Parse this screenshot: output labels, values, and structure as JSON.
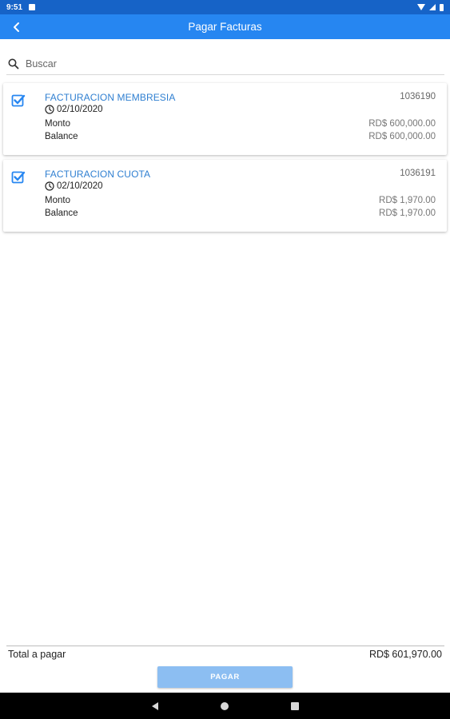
{
  "status_bar": {
    "time": "9:51"
  },
  "app_bar": {
    "title": "Pagar Facturas"
  },
  "search": {
    "placeholder": "Buscar",
    "value": ""
  },
  "invoices": [
    {
      "title": "FACTURACION MEMBRESIA",
      "number": "1036190",
      "date": "02/10/2020",
      "monto_label": "Monto",
      "monto": "RD$ 600,000.00",
      "balance_label": "Balance",
      "balance": "RD$ 600,000.00",
      "checked": true
    },
    {
      "title": "FACTURACION CUOTA",
      "number": "1036191",
      "date": "02/10/2020",
      "monto_label": "Monto",
      "monto": "RD$ 1,970.00",
      "balance_label": "Balance",
      "balance": "RD$ 1,970.00",
      "checked": true
    }
  ],
  "footer": {
    "total_label": "Total a pagar",
    "total_value": "RD$ 601,970.00",
    "pay_button": "PAGAR"
  },
  "colors": {
    "primary": "#2686f1",
    "status_bar": "#1663c7",
    "link": "#2f7fd1",
    "pay_button": "#8cbef2"
  },
  "icons": {
    "back": "arrow-back-icon",
    "search": "search-icon",
    "checkbox": "checkbox-checked-icon",
    "date": "clock-icon"
  }
}
